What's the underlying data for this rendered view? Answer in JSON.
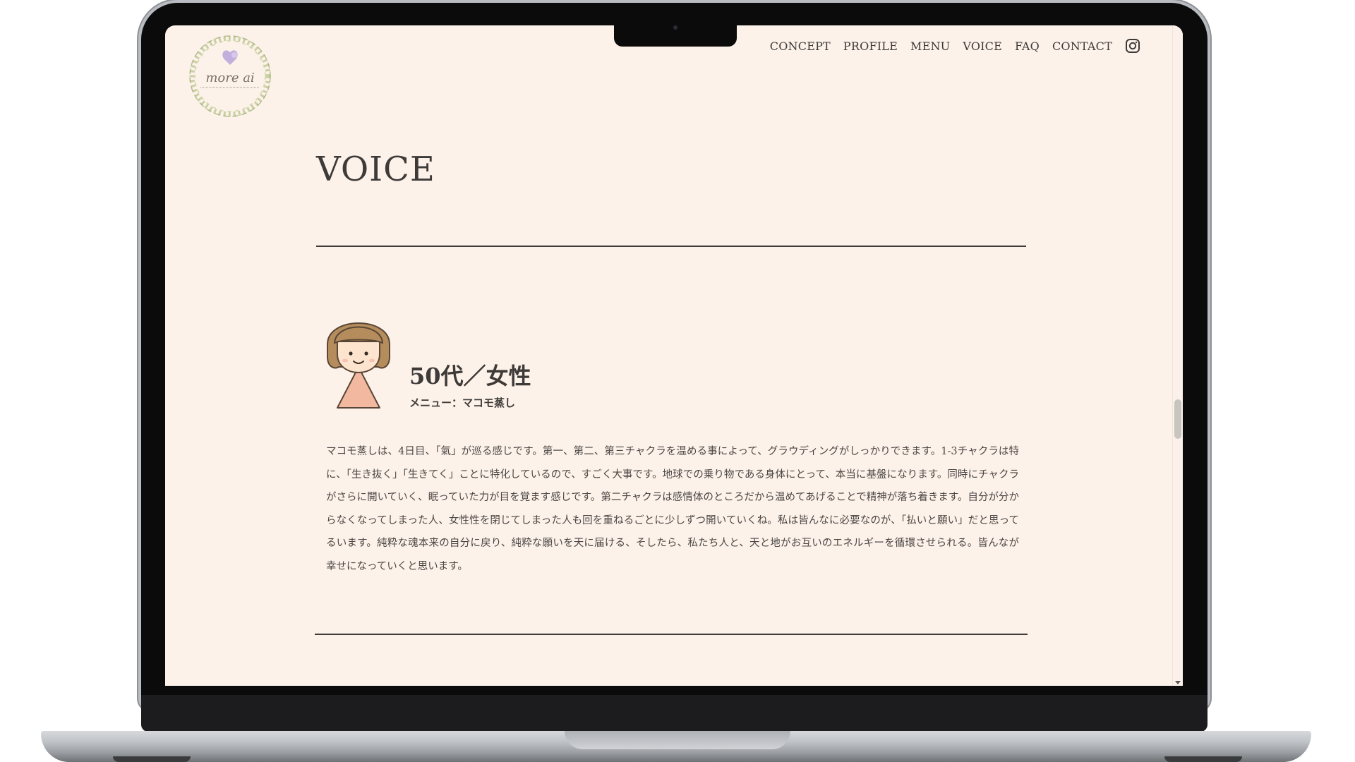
{
  "header": {
    "logo_text": "more ai",
    "nav": [
      "CONCEPT",
      "PROFILE",
      "MENU",
      "VOICE",
      "FAQ",
      "CONTACT"
    ],
    "instagram_icon": "instagram-icon"
  },
  "page": {
    "title": "VOICE"
  },
  "voice": {
    "heading": "50代／女性",
    "menu": "メニュー：マコモ蒸し",
    "body": "マコモ蒸しは、4日目、「氣」が巡る感じです。第一、第二、第三チャクラを温める事によって、グラウディングがしっかりできます。1-3チャクラは特に、「生き抜く」「生きてく」ことに特化しているので、すごく大事です。地球での乗り物である身体にとって、本当に基盤になります。同時にチャクラがさらに開いていく、眠っていた力が目を覚ます感じです。第二チャクラは感情体のところだから温めてあげることで精神が落ち着きます。自分が分からなくなってしまった人、女性性を閉じてしまった人も回を重ねるごとに少しずつ開いていくね。私は皆んなに必要なのが、「払いと願い」だと思ってるいます。純粋な魂本来の自分に戻り、純粋な願いを天に届ける、そしたら、私たち人と、天と地がお互いのエネルギーを循環させられる。皆んなが幸せになっていくと思います。"
  },
  "colors": {
    "background": "#fdf2ea",
    "text": "#3d3a38",
    "avatar_hair": "#b58d5c",
    "avatar_dress": "#f2b8a0"
  }
}
